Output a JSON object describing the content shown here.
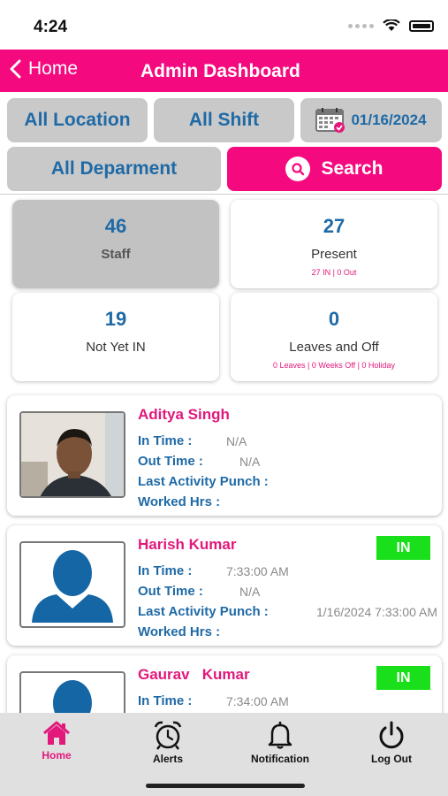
{
  "status_bar": {
    "time": "4:24"
  },
  "header": {
    "back_label": "Home",
    "title": "Admin Dashboard"
  },
  "filters": {
    "location": "All Location",
    "shift": "All Shift",
    "date": "01/16/2024",
    "department": "All Deparment",
    "search": "Search"
  },
  "stats": [
    {
      "value": "46",
      "label": "Staff",
      "sub": ""
    },
    {
      "value": "27",
      "label": "Present",
      "sub": "27 IN | 0 Out"
    },
    {
      "value": "19",
      "label": "Not Yet IN",
      "sub": ""
    },
    {
      "value": "0",
      "label": "Leaves and Off",
      "sub": "0 Leaves | 0 Weeks Off | 0 Holiday"
    }
  ],
  "labels": {
    "in_time": "In Time :",
    "out_time": "Out Time :",
    "last_punch": "Last Activity Punch :",
    "worked": "Worked Hrs :"
  },
  "employees": [
    {
      "name": "Aditya Singh",
      "in_time": "N/A",
      "out_time": "N/A",
      "last_punch": "",
      "worked": "",
      "status": ""
    },
    {
      "name": "Harish Kumar",
      "in_time": "7:33:00 AM",
      "out_time": "N/A",
      "last_punch": "1/16/2024 7:33:00 AM",
      "worked": "",
      "status": "IN"
    },
    {
      "name": "Gaurav   Kumar",
      "in_time": "7:34:00 AM",
      "out_time": "",
      "last_punch": "",
      "worked": "",
      "status": "IN"
    }
  ],
  "tabs": [
    {
      "label": "Home",
      "icon": "home-icon"
    },
    {
      "label": "Alerts",
      "icon": "alarm-clock-icon"
    },
    {
      "label": "Notification",
      "icon": "bell-icon"
    },
    {
      "label": "Log Out",
      "icon": "power-icon"
    }
  ],
  "colors": {
    "brand_pink": "#f5097f",
    "accent_blue": "#1f6aa6",
    "status_green": "#19e01a"
  }
}
